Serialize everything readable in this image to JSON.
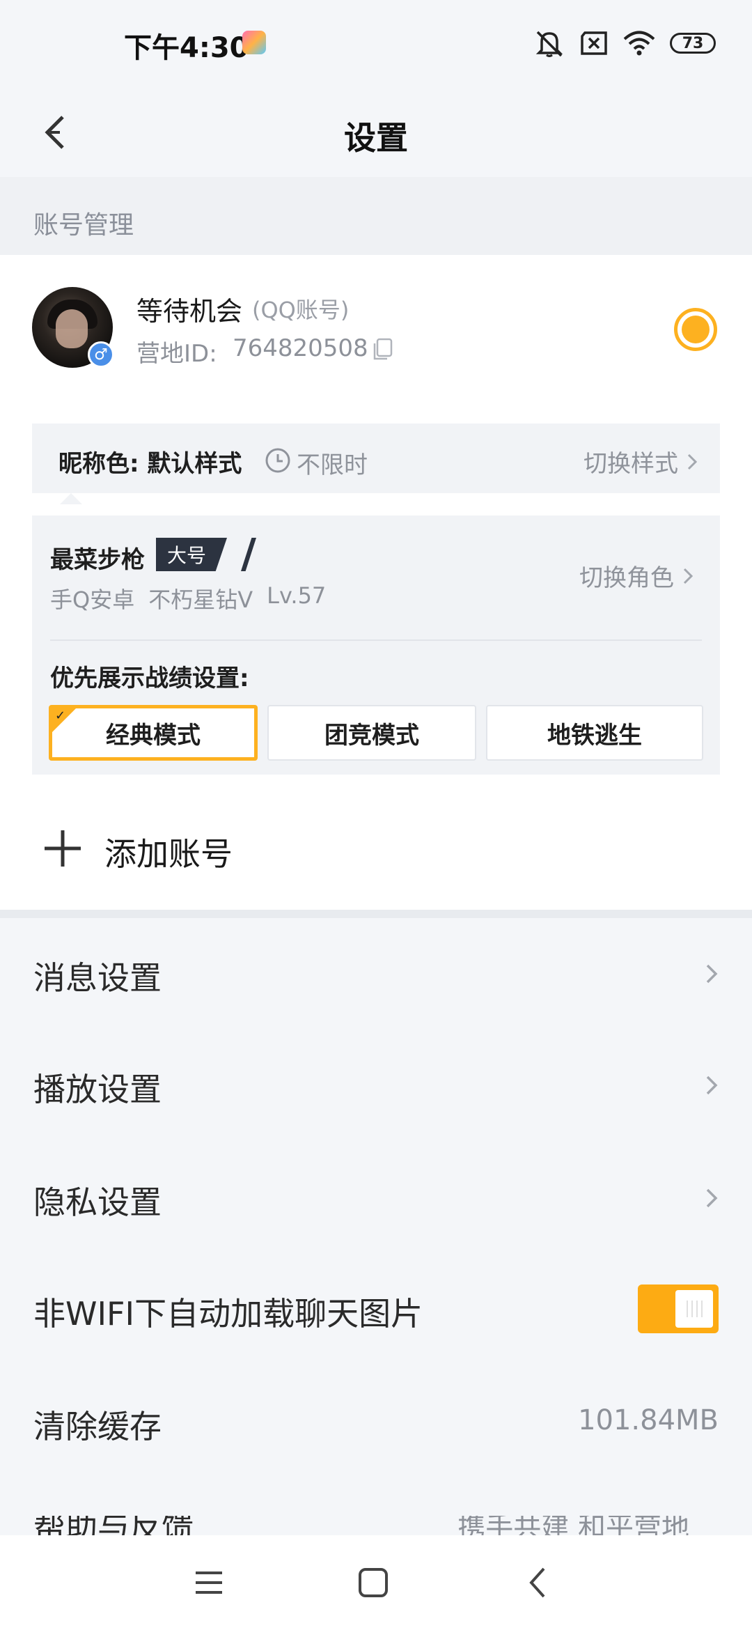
{
  "status_bar": {
    "time": "下午4:30",
    "battery": "73",
    "icons": [
      "app-game-icon",
      "mute-icon",
      "sim-off-icon",
      "wifi-icon",
      "battery-icon"
    ]
  },
  "header": {
    "title": "设置",
    "back_icon": "back-arrow-icon"
  },
  "account_section": {
    "label": "账号管理",
    "account": {
      "name": "等待机会",
      "type": "(QQ账号)",
      "id_label": "营地ID:",
      "id_value": "764820508",
      "gender": "♂",
      "selected": true
    },
    "nickname_color": {
      "label": "昵称色: 默认样式",
      "limit": "不限时",
      "switch_label": "切换样式"
    },
    "role": {
      "name": "最菜步枪",
      "tag": "大号",
      "meta": [
        "手Q安卓",
        "不朽星钻V",
        "Lv.57"
      ],
      "switch_label": "切换角色",
      "pref_label": "优先展示战绩设置:",
      "modes": [
        "经典模式",
        "团竞模式",
        "地铁逃生"
      ],
      "active_mode_index": 0
    },
    "add_account": "添加账号"
  },
  "settings": {
    "message": "消息设置",
    "playback": "播放设置",
    "privacy": "隐私设置",
    "auto_load_images": "非WIFI下自动加载聊天图片",
    "auto_load_images_on": true,
    "clear_cache": "清除缓存",
    "cache_size": "101.84MB",
    "help": "帮助与反馈",
    "help_value": "携手共建 和平营地"
  },
  "colors": {
    "accent": "#fdb120",
    "toggle": "#fdab13",
    "background": "#f4f6f9",
    "muted_text": "#8d9199"
  },
  "nav_bar": {
    "icons": [
      "menu-icon",
      "home-square-icon",
      "back-chevron-icon"
    ]
  }
}
